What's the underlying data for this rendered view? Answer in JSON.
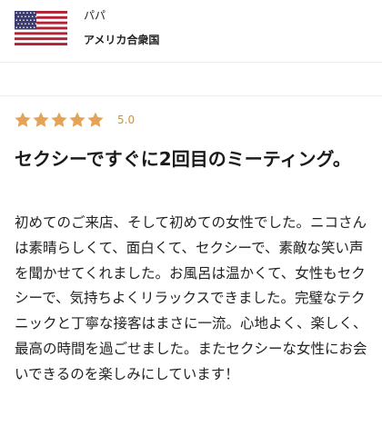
{
  "reviewer": {
    "name": "パパ",
    "country": "アメリカ合衆国",
    "flag_icon": "us-flag-icon"
  },
  "rating": {
    "stars": 5,
    "max_stars": 5,
    "value_text": "5.0",
    "star_color": "#e5a358"
  },
  "review": {
    "title": "セクシーですぐに2回目のミーティング。",
    "body": "初めてのご来店、そして初めての女性でした。ニコさんは素晴らしくて、面白くて、セクシーで、素敵な笑い声を聞かせてくれました。お風呂は温かくて、女性もセクシーで、気持ちよくリラックスできました。完璧なテクニックと丁寧な接客はまさに一流。心地よく、楽しく、最高の時間を過ごせました。またセクシーな女性にお会いできるのを楽しみにしています！"
  },
  "colors": {
    "accent": "#c8924a",
    "divider": "#ececec",
    "flag_red": "#b22234",
    "flag_blue": "#3c3b6e"
  }
}
